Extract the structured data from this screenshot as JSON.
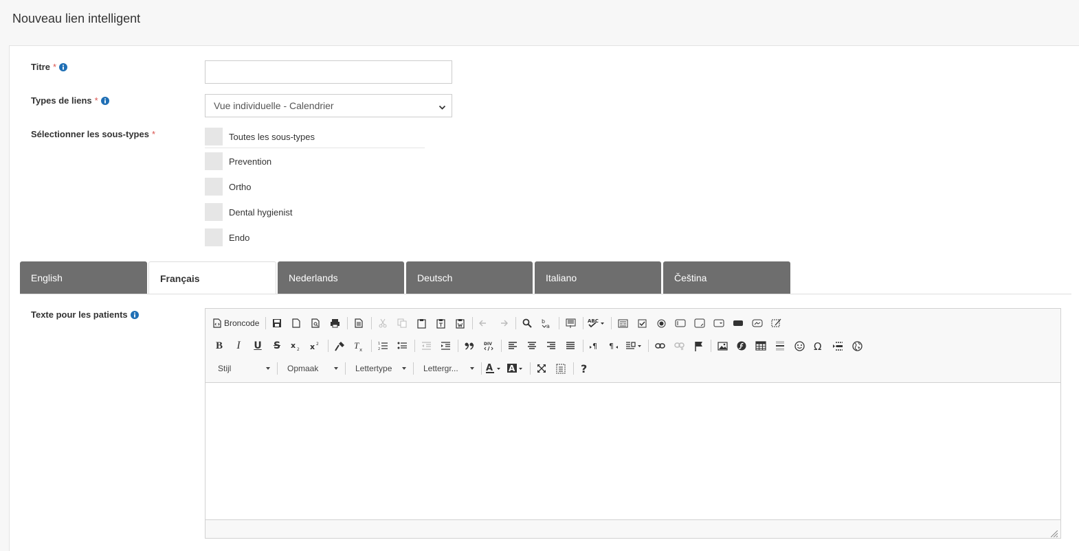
{
  "page": {
    "title": "Nouveau lien intelligent"
  },
  "form": {
    "title_label": "Titre",
    "title_value": "",
    "link_types_label": "Types de liens",
    "link_types_value": "Vue individuelle - Calendrier",
    "subtypes_label": "Sélectionner les sous-types",
    "required_mark": "*",
    "subtypes": [
      {
        "label": "Toutes les sous-types",
        "checked": false
      },
      {
        "label": "Prevention",
        "checked": false
      },
      {
        "label": "Ortho",
        "checked": false
      },
      {
        "label": "Dental hygienist",
        "checked": false
      },
      {
        "label": "Endo",
        "checked": false
      }
    ],
    "patient_text_label": "Texte pour les patients"
  },
  "tabs": [
    {
      "label": "English",
      "active": false
    },
    {
      "label": "Français",
      "active": true
    },
    {
      "label": "Nederlands",
      "active": false
    },
    {
      "label": "Deutsch",
      "active": false
    },
    {
      "label": "Italiano",
      "active": false
    },
    {
      "label": "Čeština",
      "active": false
    }
  ],
  "editor": {
    "source_label": "Broncode",
    "combos": {
      "style": "Stijl",
      "format": "Opmaak",
      "font": "Lettertype",
      "size": "Lettergr..."
    }
  },
  "colors": {
    "accent_info": "#1f6fb5",
    "tab_inactive": "#6e6e6e",
    "required": "#d9534f"
  }
}
